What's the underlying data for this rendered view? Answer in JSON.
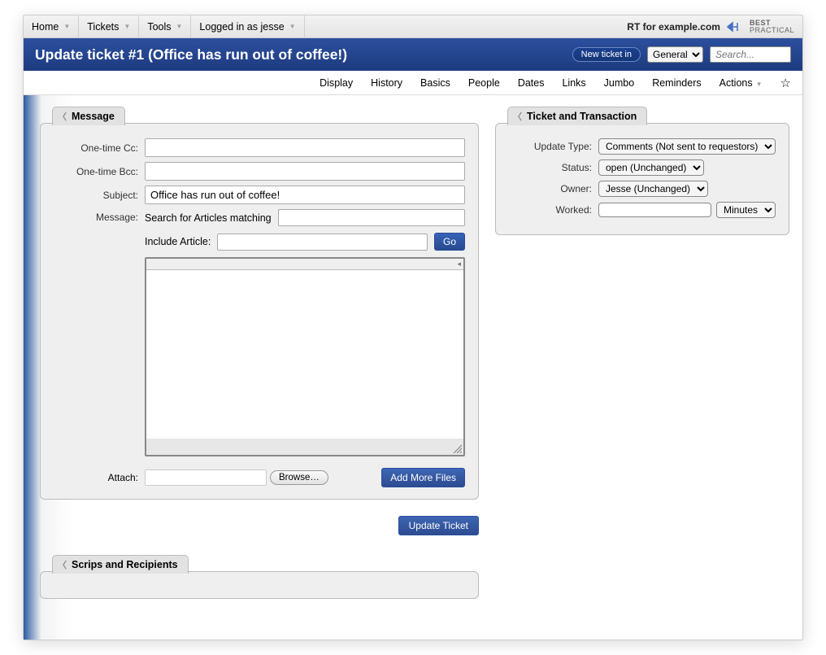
{
  "topbar": {
    "items": [
      "Home",
      "Tickets",
      "Tools",
      "Logged in as jesse"
    ],
    "right_label": "RT for example.com",
    "logo_line1": "BEST",
    "logo_line2": "PRACTICAL"
  },
  "bluebar": {
    "title": "Update ticket #1 (Office has run out of coffee!)",
    "newticket_label": "New ticket in",
    "select_option": "General",
    "search_placeholder": "Search..."
  },
  "subnav": [
    "Display",
    "History",
    "Basics",
    "People",
    "Dates",
    "Links",
    "Jumbo",
    "Reminders",
    "Actions"
  ],
  "panels": {
    "message": {
      "title": "Message",
      "onetime_cc_label": "One-time Cc:",
      "onetime_bcc_label": "One-time Bcc:",
      "subject_label": "Subject:",
      "subject_value": "Office has run out of coffee!",
      "message_label": "Message:",
      "search_articles_label": "Search for Articles matching",
      "include_article_label": "Include Article:",
      "go_label": "Go",
      "attach_label": "Attach:",
      "browse_label": "Browse…",
      "addmore_label": "Add More Files"
    },
    "ticket": {
      "title": "Ticket and Transaction",
      "update_type_label": "Update Type:",
      "update_type_value": "Comments (Not sent to requestors)",
      "status_label": "Status:",
      "status_value": "open (Unchanged)",
      "owner_label": "Owner:",
      "owner_value": "Jesse (Unchanged)",
      "worked_label": "Worked:",
      "worked_unit": "Minutes"
    },
    "scrips": {
      "title": "Scrips and Recipients"
    },
    "update_button": "Update Ticket"
  }
}
